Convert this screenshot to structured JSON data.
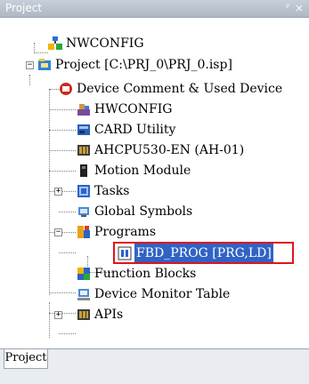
{
  "panel": {
    "title": "Project",
    "pin_glyph": "ᵖ",
    "close_glyph": "×"
  },
  "tree": {
    "nodes": [
      {
        "label": "NWCONFIG",
        "icon": "nwconfig-icon"
      },
      {
        "label": "Project [C:\\PRJ_0\\PRJ_0.isp]",
        "icon": "project-icon",
        "expander": "−"
      },
      {
        "label": "Device Comment & Used Device",
        "icon": "device-comment-icon"
      },
      {
        "label": "HWCONFIG",
        "icon": "hwconfig-icon"
      },
      {
        "label": "CARD Utility",
        "icon": "card-utility-icon"
      },
      {
        "label": "AHCPU530-EN (AH-01)",
        "icon": "cpu-icon"
      },
      {
        "label": "Motion Module",
        "icon": "motion-module-icon"
      },
      {
        "label": "Tasks",
        "icon": "tasks-icon",
        "expander": "+"
      },
      {
        "label": "Global Symbols",
        "icon": "global-symbols-icon"
      },
      {
        "label": "Programs",
        "icon": "programs-icon",
        "expander": "−"
      },
      {
        "label": "FBD_PROG [PRG,LD]",
        "icon": "program-file-icon",
        "selected": true
      },
      {
        "label": "Function Blocks",
        "icon": "function-blocks-icon"
      },
      {
        "label": "Device Monitor Table",
        "icon": "device-monitor-icon"
      },
      {
        "label": "APIs",
        "icon": "apis-icon",
        "expander": "+"
      }
    ]
  },
  "tabs": [
    {
      "label": "Project"
    }
  ]
}
